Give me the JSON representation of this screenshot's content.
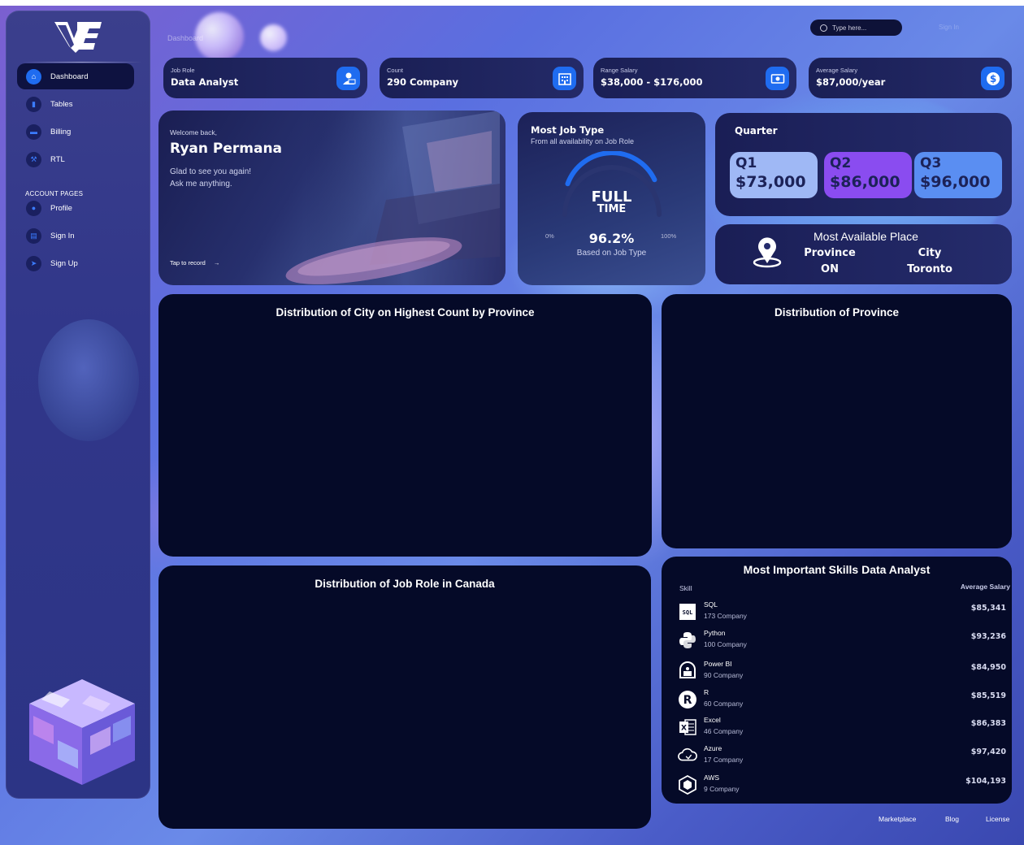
{
  "app": {
    "logo": "MVE"
  },
  "sidebar": {
    "items": [
      {
        "label": "Dashboard",
        "icon": "home-icon"
      },
      {
        "label": "Tables",
        "icon": "stats-icon"
      },
      {
        "label": "Billing",
        "icon": "credit-card-icon"
      },
      {
        "label": "RTL",
        "icon": "wrench-icon"
      }
    ],
    "section_label": "ACCOUNT PAGES",
    "account_items": [
      {
        "label": "Profile",
        "icon": "user-icon"
      },
      {
        "label": "Sign In",
        "icon": "document-icon"
      },
      {
        "label": "Sign Up",
        "icon": "rocket-icon"
      }
    ]
  },
  "header": {
    "breadcrumb": "Dashboard",
    "search_placeholder": "Type here...",
    "signin": "Sign In"
  },
  "stats": [
    {
      "label": "Job Role",
      "value": "Data Analyst",
      "icon": "person-laptop-icon"
    },
    {
      "label": "Count",
      "value": "290 Company",
      "icon": "building-icon"
    },
    {
      "label": "Range Salary",
      "value": "$38,000 - $176,000",
      "icon": "money-icon"
    },
    {
      "label": "Average Salary",
      "value": "$87,000/year",
      "icon": "dollar-icon"
    }
  ],
  "welcome": {
    "greeting": "Welcome back,",
    "name": "Ryan Permana",
    "line1": "Glad to see you again!",
    "line2": "Ask me anything.",
    "tap": "Tap to record"
  },
  "job_type": {
    "title": "Most Job Type",
    "subtitle": "From all availability on Job Role",
    "center_line1": "FULL",
    "center_line2": "TIME",
    "min_label": "0%",
    "max_label": "100%",
    "value_label": "96.2%",
    "value": 96.2,
    "caption": "Based on Job Type"
  },
  "quarter": {
    "title": "Quarter",
    "items": [
      {
        "q": "Q1",
        "value": "$73,000",
        "color": "#9fb8f5"
      },
      {
        "q": "Q2",
        "value": "$86,000",
        "color": "#8a4cf0"
      },
      {
        "q": "Q3",
        "value": "$96,000",
        "color": "#5a8ef2"
      }
    ]
  },
  "place": {
    "title": "Most Available Place",
    "province_label": "Province",
    "province_value": "ON",
    "city_label": "City",
    "city_value": "Toronto"
  },
  "panels": {
    "city_by_province": "Distribution of City on Highest Count by Province",
    "province": "Distribution of Province",
    "job_role": "Distribution of Job Role in Canada"
  },
  "skills": {
    "title": "Most Important Skills Data Analyst",
    "col_skill": "Skill",
    "col_salary": "Average Salary",
    "rows": [
      {
        "name": "SQL",
        "count": "173 Company",
        "salary": "$85,341",
        "icon": "sql-icon"
      },
      {
        "name": "Python",
        "count": "100 Company",
        "salary": "$93,236",
        "icon": "python-icon"
      },
      {
        "name": "Power BI",
        "count": "90 Company",
        "salary": "$84,950",
        "icon": "powerbi-icon"
      },
      {
        "name": "R",
        "count": "60 Company",
        "salary": "$85,519",
        "icon": "r-icon"
      },
      {
        "name": "Excel",
        "count": "46 Company",
        "salary": "$86,383",
        "icon": "excel-icon"
      },
      {
        "name": "Azure",
        "count": "17 Company",
        "salary": "$97,420",
        "icon": "azure-cloud-icon"
      },
      {
        "name": "AWS",
        "count": "9 Company",
        "salary": "$104,193",
        "icon": "aws-icon"
      }
    ]
  },
  "footer": {
    "links": [
      "Marketplace",
      "Blog",
      "License"
    ]
  }
}
